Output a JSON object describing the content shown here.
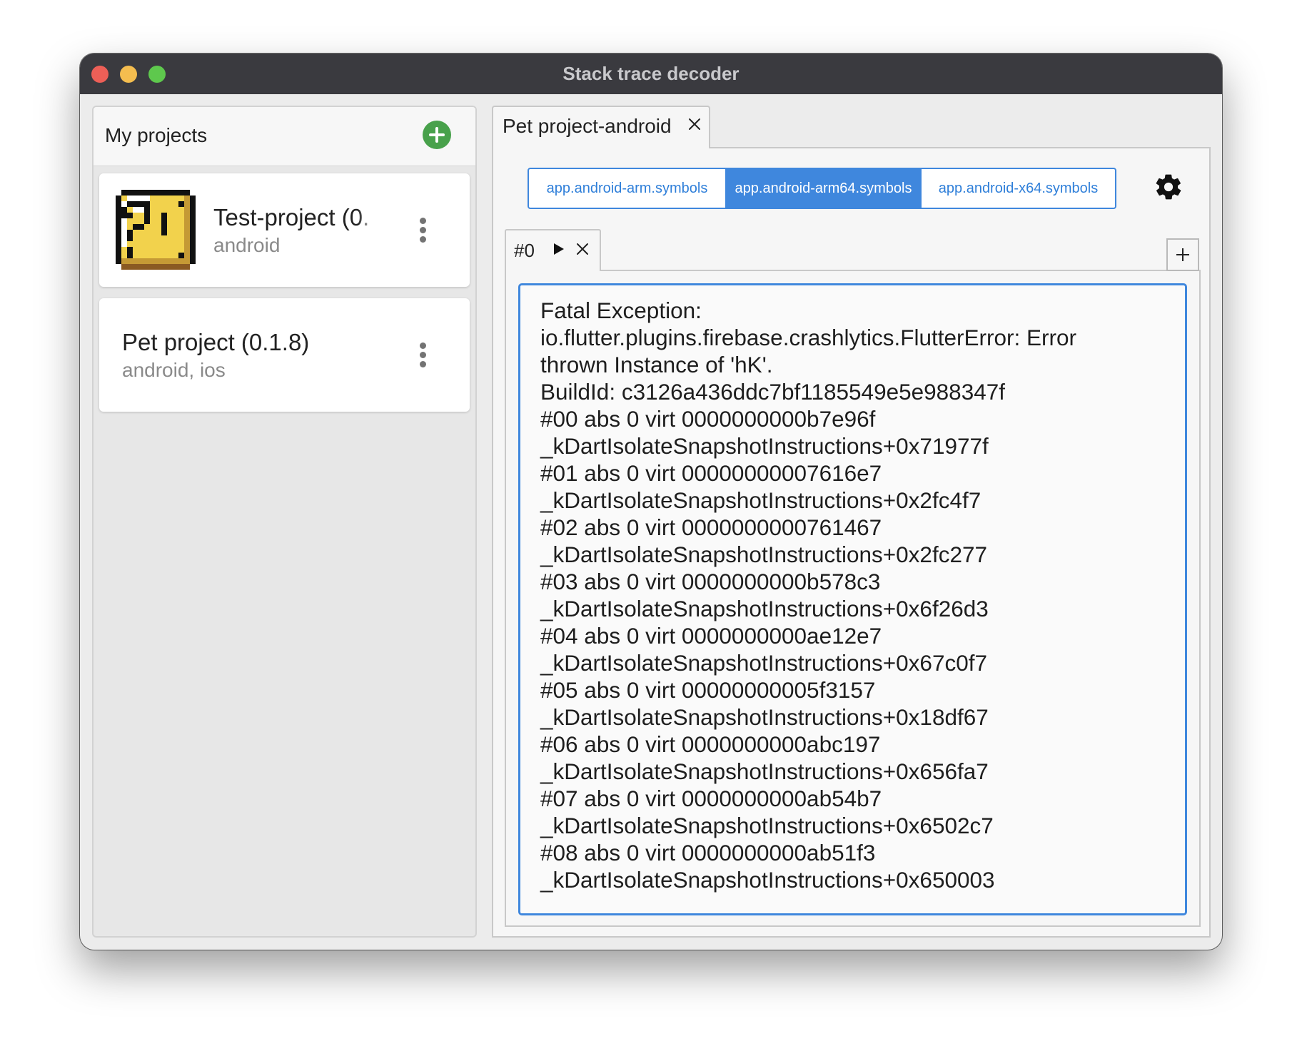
{
  "window": {
    "title": "Stack trace decoder"
  },
  "sidebar": {
    "header_title": "My projects",
    "add_button_icon": "plus-circle-icon",
    "projects": [
      {
        "name": "Test-project (0.",
        "platforms": "android",
        "avatar_icon": "pixel-question-block-icon",
        "menu_icon": "more-vertical-icon"
      },
      {
        "name": "Pet project (0.1.8)",
        "platforms": "android, ios",
        "menu_icon": "more-vertical-icon"
      }
    ]
  },
  "main": {
    "tab": {
      "label": "Pet project-android",
      "close_icon": "close-icon"
    },
    "symbols": {
      "options": [
        "app.android-arm.symbols",
        "app.android-arm64.symbols",
        "app.android-x64.symbols"
      ],
      "selected": "app.android-arm64.symbols"
    },
    "settings_icon": "gear-icon",
    "trace_tab": {
      "label": "#0",
      "run_icon": "play-icon",
      "close_icon": "close-icon"
    },
    "add_trace_icon": "plus-icon",
    "trace_text": "Fatal Exception:\nio.flutter.plugins.firebase.crashlytics.FlutterError: Error\nthrown Instance of 'hK'.\nBuildId: c3126a436ddc7bf1185549e5e988347f\n#00 abs 0 virt 0000000000b7e96f\n_kDartIsolateSnapshotInstructions+0x71977f\n#01 abs 0 virt 00000000007616e7\n_kDartIsolateSnapshotInstructions+0x2fc4f7\n#02 abs 0 virt 0000000000761467\n_kDartIsolateSnapshotInstructions+0x2fc277\n#03 abs 0 virt 0000000000b578c3\n_kDartIsolateSnapshotInstructions+0x6f26d3\n#04 abs 0 virt 0000000000ae12e7\n_kDartIsolateSnapshotInstructions+0x67c0f7\n#05 abs 0 virt 00000000005f3157\n_kDartIsolateSnapshotInstructions+0x18df67\n#06 abs 0 virt 0000000000abc197\n_kDartIsolateSnapshotInstructions+0x656fa7\n#07 abs 0 virt 0000000000ab54b7\n_kDartIsolateSnapshotInstructions+0x6502c7\n#08 abs 0 virt 0000000000ab51f3\n_kDartIsolateSnapshotInstructions+0x650003"
  },
  "colors": {
    "accent": "#3f87dd",
    "add_button": "#48a14b",
    "titlebar": "#3a3a3f"
  }
}
